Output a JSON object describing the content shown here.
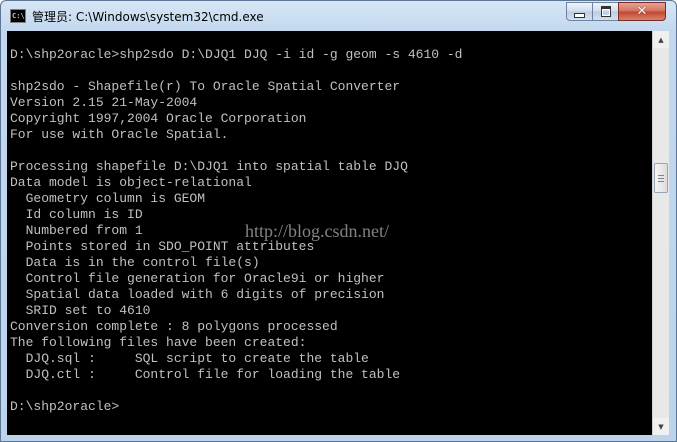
{
  "window": {
    "title": "管理员: C:\\Windows\\system32\\cmd.exe",
    "icon": "cmd-icon",
    "icon_label": "C:\\",
    "controls": {
      "minimize": "minimize-icon",
      "maximize": "maximize-icon",
      "close": "✕"
    }
  },
  "console": {
    "lines": [
      "",
      "D:\\shp2oracle>shp2sdo D:\\DJQ1 DJQ -i id -g geom -s 4610 -d",
      "",
      "shp2sdo - Shapefile(r) To Oracle Spatial Converter",
      "Version 2.15 21-May-2004",
      "Copyright 1997,2004 Oracle Corporation",
      "For use with Oracle Spatial.",
      "",
      "Processing shapefile D:\\DJQ1 into spatial table DJQ",
      "Data model is object-relational",
      "  Geometry column is GEOM",
      "  Id column is ID",
      "  Numbered from 1",
      "  Points stored in SDO_POINT attributes",
      "  Data is in the control file(s)",
      "  Control file generation for Oracle9i or higher",
      "  Spatial data loaded with 6 digits of precision",
      "  SRID set to 4610",
      "Conversion complete : 8 polygons processed",
      "The following files have been created:",
      "  DJQ.sql :     SQL script to create the table",
      "  DJQ.ctl :     Control file for loading the table",
      "",
      "D:\\shp2oracle>"
    ],
    "watermark": "http://blog.csdn.net/"
  },
  "scrollbar": {
    "up": "▲",
    "down": "▼"
  },
  "colors": {
    "console_bg": "#000000",
    "console_fg": "#c0c0c0",
    "close_button": "#c2452f"
  }
}
